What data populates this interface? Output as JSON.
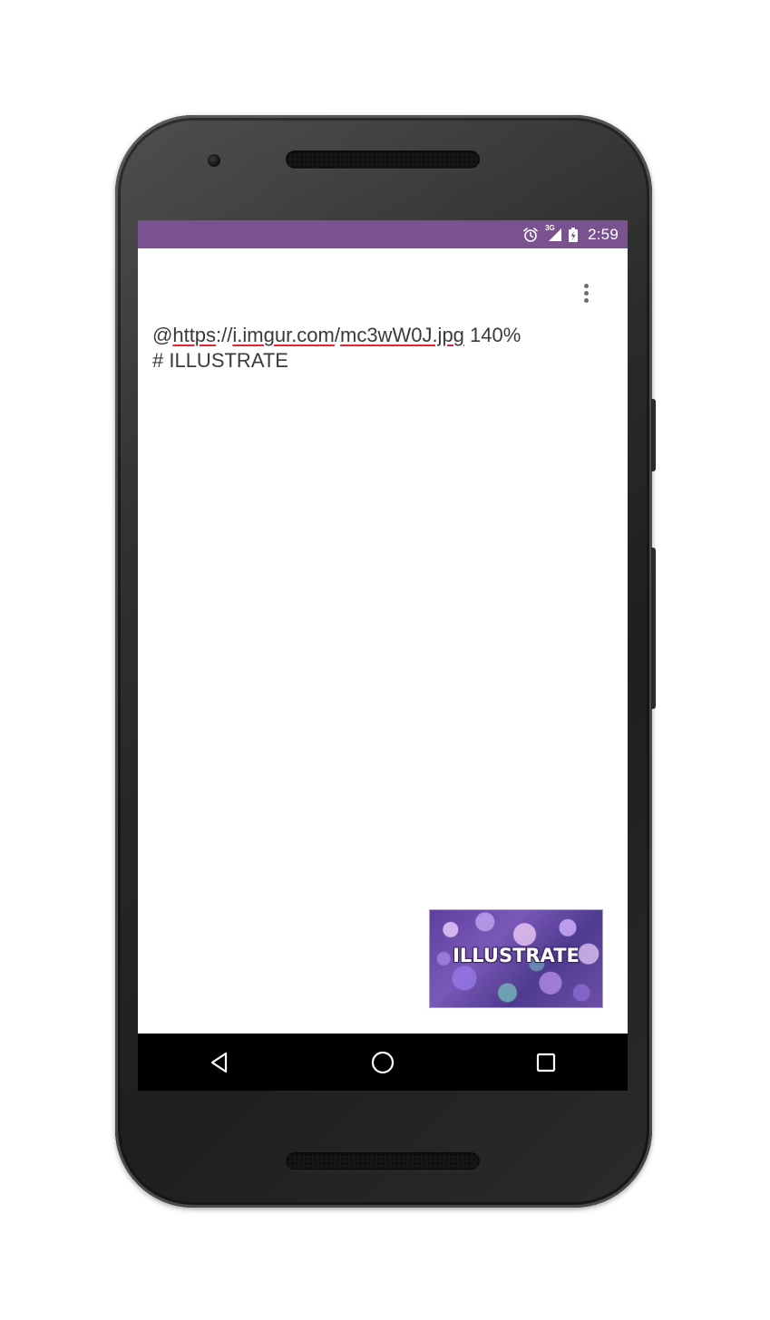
{
  "status_bar": {
    "time": "2:59",
    "network_type": "3G",
    "icons": [
      "alarm-icon",
      "signal-icon",
      "battery-icon"
    ],
    "color": "#7b5290"
  },
  "app_bar": {
    "menu_icon": "overflow-menu-icon"
  },
  "editor": {
    "line1": {
      "prefix": "@",
      "part_https": "https",
      "part_sep": "://",
      "part_host": "i.imgur.com",
      "part_slash": "/",
      "part_file": "mc3wW0J.jpg",
      "suffix": " 140%"
    },
    "line2": "# ILLUSTRATE"
  },
  "preview": {
    "label": "ILLUSTRATE"
  },
  "nav_bar": {
    "icons": [
      "back-icon",
      "home-icon",
      "recents-icon"
    ]
  }
}
